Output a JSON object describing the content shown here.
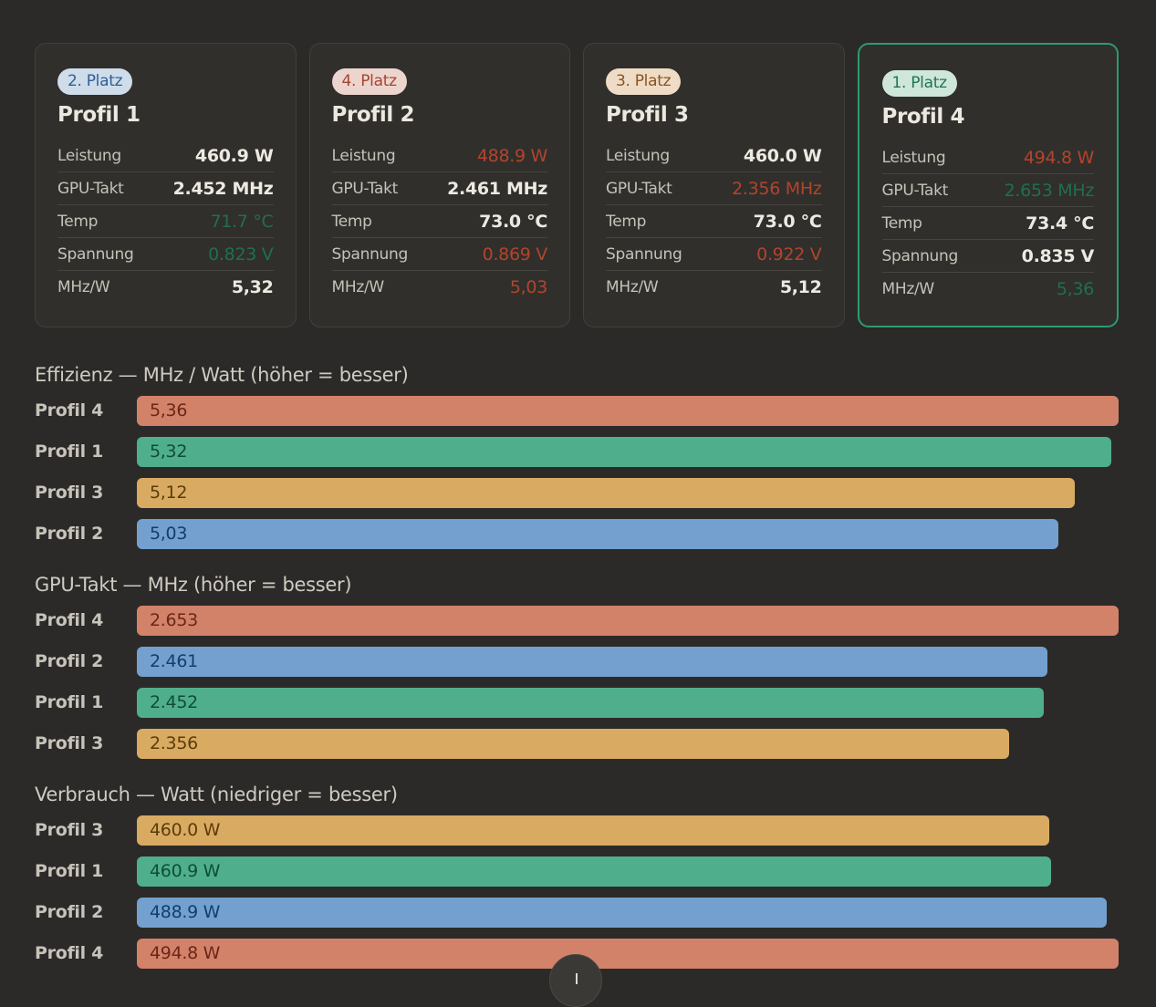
{
  "colors": {
    "Profil 1": "#4faf8c",
    "Profil 2": "#74a0cf",
    "Profil 3": "#d9ab62",
    "Profil 4": "#d3826a"
  },
  "value_colors": {
    "Profil 1": "#0f4d36",
    "Profil 2": "#0f3f6f",
    "Profil 3": "#5b3c0a",
    "Profil 4": "#6a2716"
  },
  "badge_styles": {
    "Profil 1": {
      "bg": "#cfdcea",
      "fg": "#2f5f95"
    },
    "Profil 2": {
      "bg": "#ecd5cf",
      "fg": "#a8452f"
    },
    "Profil 3": {
      "bg": "#efdcc7",
      "fg": "#8a5422"
    },
    "Profil 4": {
      "bg": "#cfe6da",
      "fg": "#1f7555"
    }
  },
  "cards": [
    {
      "profile": "Profil 1",
      "rank": "2. Platz",
      "name": "Profil 1",
      "winner": false,
      "metrics": [
        {
          "label": "Leistung",
          "value": "460.9 W",
          "state": "normal"
        },
        {
          "label": "GPU-Takt",
          "value": "2.452 MHz",
          "state": "normal"
        },
        {
          "label": "Temp",
          "value": "71.7 °C",
          "state": "best"
        },
        {
          "label": "Spannung",
          "value": "0.823 V",
          "state": "best"
        },
        {
          "label": "MHz/W",
          "value": "5,32",
          "state": "normal"
        }
      ]
    },
    {
      "profile": "Profil 2",
      "rank": "4. Platz",
      "name": "Profil 2",
      "winner": false,
      "metrics": [
        {
          "label": "Leistung",
          "value": "488.9 W",
          "state": "worst"
        },
        {
          "label": "GPU-Takt",
          "value": "2.461 MHz",
          "state": "normal"
        },
        {
          "label": "Temp",
          "value": "73.0 °C",
          "state": "normal"
        },
        {
          "label": "Spannung",
          "value": "0.869 V",
          "state": "worst"
        },
        {
          "label": "MHz/W",
          "value": "5,03",
          "state": "worst"
        }
      ]
    },
    {
      "profile": "Profil 3",
      "rank": "3. Platz",
      "name": "Profil 3",
      "winner": false,
      "metrics": [
        {
          "label": "Leistung",
          "value": "460.0 W",
          "state": "normal"
        },
        {
          "label": "GPU-Takt",
          "value": "2.356 MHz",
          "state": "worst"
        },
        {
          "label": "Temp",
          "value": "73.0 °C",
          "state": "normal"
        },
        {
          "label": "Spannung",
          "value": "0.922 V",
          "state": "worst"
        },
        {
          "label": "MHz/W",
          "value": "5,12",
          "state": "normal"
        }
      ]
    },
    {
      "profile": "Profil 4",
      "rank": "1. Platz",
      "name": "Profil 4",
      "winner": true,
      "metrics": [
        {
          "label": "Leistung",
          "value": "494.8 W",
          "state": "worst"
        },
        {
          "label": "GPU-Takt",
          "value": "2.653 MHz",
          "state": "best"
        },
        {
          "label": "Temp",
          "value": "73.4 °C",
          "state": "normal"
        },
        {
          "label": "Spannung",
          "value": "0.835 V",
          "state": "normal"
        },
        {
          "label": "MHz/W",
          "value": "5,36",
          "state": "best"
        }
      ]
    }
  ],
  "chart_data": [
    {
      "type": "bar",
      "orientation": "horizontal",
      "title": "Effizienz — MHz / Watt (höher = besser)",
      "categories": [
        "Profil 4",
        "Profil 1",
        "Profil 3",
        "Profil 2"
      ],
      "values": [
        5.36,
        5.32,
        5.12,
        5.03
      ],
      "value_labels": [
        "5,36",
        "5,32",
        "5,12",
        "5,03"
      ],
      "xlim": [
        0,
        5.36
      ]
    },
    {
      "type": "bar",
      "orientation": "horizontal",
      "title": "GPU-Takt — MHz (höher = besser)",
      "categories": [
        "Profil 4",
        "Profil 2",
        "Profil 1",
        "Profil 3"
      ],
      "values": [
        2653,
        2461,
        2452,
        2356
      ],
      "value_labels": [
        "2.653",
        "2.461",
        "2.452",
        "2.356"
      ],
      "xlim": [
        0,
        2653
      ]
    },
    {
      "type": "bar",
      "orientation": "horizontal",
      "title": "Verbrauch — Watt (niedriger = besser)",
      "categories": [
        "Profil 3",
        "Profil 1",
        "Profil 2",
        "Profil 4"
      ],
      "values": [
        460.0,
        460.9,
        488.9,
        494.8
      ],
      "value_labels": [
        "460.0 W",
        "460.9 W",
        "488.9 W",
        "494.8 W"
      ],
      "xlim": [
        0,
        494.8
      ]
    }
  ],
  "scroll_button": {
    "icon": "arrow-down-icon"
  }
}
